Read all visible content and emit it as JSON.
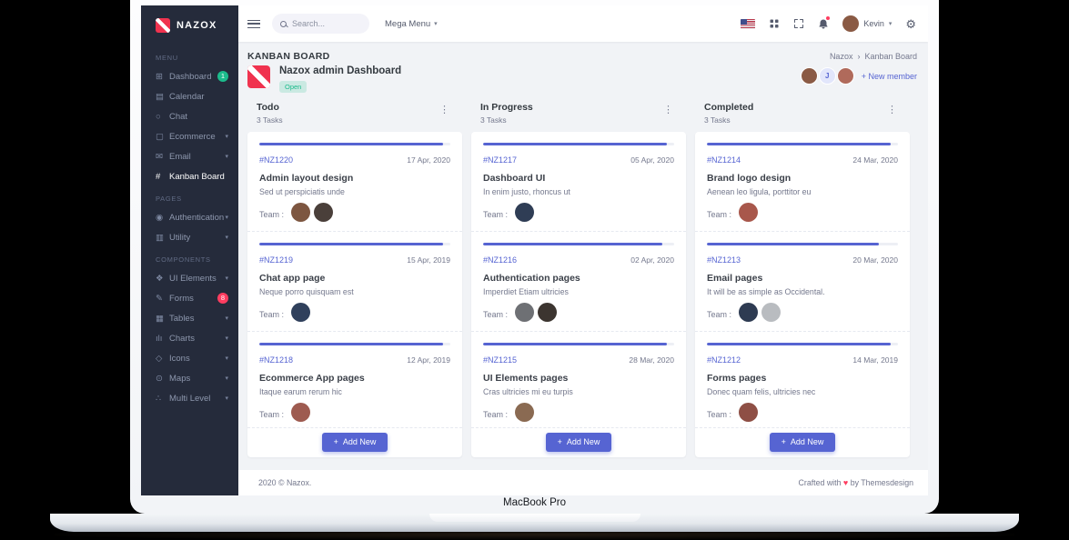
{
  "device": {
    "label": "MacBook Pro"
  },
  "colors": {
    "accent": "#5664d2",
    "success": "#1cbb8c",
    "danger": "#ff3d60",
    "sidebar_bg": "#252b3b"
  },
  "icons": {
    "chevron_down": "▾",
    "breadcrumb_sep": "›",
    "dots_vertical": "⋮",
    "plus": "+",
    "heart": "♥",
    "gear": "⚙",
    "dashboard": "⊞",
    "calendar": "▤",
    "chat": "○",
    "ecommerce": "▢",
    "email": "✉",
    "kanban": "#",
    "authentication": "◉",
    "utility": "▥",
    "ui_elements": "❖",
    "forms": "✎",
    "tables": "▦",
    "charts": "ılı",
    "icons_item": "◇",
    "maps": "⊙",
    "multi_level": "∴"
  },
  "sidebar": {
    "brand": "NAZOX",
    "sections": [
      {
        "label": "MENU",
        "items": [
          {
            "label": "Dashboard",
            "badge": "1"
          },
          {
            "label": "Calendar"
          },
          {
            "label": "Chat"
          },
          {
            "label": "Ecommerce"
          },
          {
            "label": "Email"
          },
          {
            "label": "Kanban Board"
          }
        ]
      },
      {
        "label": "PAGES",
        "items": [
          {
            "label": "Authentication"
          },
          {
            "label": "Utility"
          }
        ]
      },
      {
        "label": "COMPONENTS",
        "items": [
          {
            "label": "UI Elements"
          },
          {
            "label": "Forms",
            "badge": "8"
          },
          {
            "label": "Tables"
          },
          {
            "label": "Charts"
          },
          {
            "label": "Icons"
          },
          {
            "label": "Maps"
          },
          {
            "label": "Multi Level"
          }
        ]
      }
    ]
  },
  "topbar": {
    "search_placeholder": "Search...",
    "mega_menu": "Mega Menu",
    "user": "Kevin"
  },
  "page": {
    "title": "KANBAN BOARD",
    "breadcrumb": [
      "Nazox",
      "Kanban Board"
    ],
    "project": {
      "name": "Nazox admin Dashboard",
      "status": "Open",
      "add_member": "New member",
      "members": [
        {
          "bg": "#8a5a44"
        },
        {
          "letter": "J",
          "bg": "#e2e6fb",
          "fg": "#5664d2"
        },
        {
          "bg": "#b06a5b"
        }
      ]
    }
  },
  "board": {
    "team_label": "Team :",
    "add_new": "Add New",
    "columns": [
      {
        "title": "Todo",
        "count": "3 Tasks",
        "cards": [
          {
            "id": "#NZ1220",
            "date": "17 Apr, 2020",
            "title": "Admin layout design",
            "desc": "Sed ut perspiciatis unde",
            "progress": 96,
            "team": [
              {
                "bg": "#7d5640"
              },
              {
                "bg": "#4a3f3a"
              }
            ]
          },
          {
            "id": "#NZ1219",
            "date": "15 Apr, 2019",
            "title": "Chat app page",
            "desc": "Neque porro quisquam est",
            "progress": 96,
            "team": [
              {
                "bg": "#30405c"
              }
            ]
          },
          {
            "id": "#NZ1218",
            "date": "12 Apr, 2019",
            "title": "Ecommerce App pages",
            "desc": "Itaque earum rerum hic",
            "progress": 96,
            "team": [
              {
                "bg": "#9e5b50"
              }
            ]
          }
        ]
      },
      {
        "title": "In Progress",
        "count": "3 Tasks",
        "cards": [
          {
            "id": "#NZ1217",
            "date": "05 Apr, 2020",
            "title": "Dashboard UI",
            "desc": "In enim justo, rhoncus ut",
            "progress": 96,
            "team": [
              {
                "bg": "#2f3d55"
              }
            ]
          },
          {
            "id": "#NZ1216",
            "date": "02 Apr, 2020",
            "title": "Authentication pages",
            "desc": "Imperdiet Etiam ultricies",
            "progress": 94,
            "team": [
              {
                "bg": "#6e7074"
              },
              {
                "bg": "#3c3530"
              }
            ]
          },
          {
            "id": "#NZ1215",
            "date": "28 Mar, 2020",
            "title": "UI Elements pages",
            "desc": "Cras ultricies mi eu turpis",
            "progress": 96,
            "team": [
              {
                "bg": "#8a6a52"
              }
            ]
          }
        ]
      },
      {
        "title": "Completed",
        "count": "3 Tasks",
        "cards": [
          {
            "id": "#NZ1214",
            "date": "24 Mar, 2020",
            "title": "Brand logo design",
            "desc": "Aenean leo ligula, porttitor eu",
            "progress": 96,
            "team": [
              {
                "bg": "#a8574b"
              }
            ]
          },
          {
            "id": "#NZ1213",
            "date": "20 Mar, 2020",
            "title": "Email pages",
            "desc": "It will be as simple as Occidental.",
            "progress": 90,
            "team": [
              {
                "bg": "#2e3b52"
              },
              {
                "bg": "#b9bcc0"
              }
            ]
          },
          {
            "id": "#NZ1212",
            "date": "14 Mar, 2019",
            "title": "Forms pages",
            "desc": "Donec quam felis, ultricies nec",
            "progress": 96,
            "team": [
              {
                "bg": "#8e4f45"
              }
            ]
          }
        ]
      }
    ]
  },
  "footer": {
    "copyright": "2020 © Nazox.",
    "crafted_prefix": "Crafted with",
    "crafted_suffix": "by Themesdesign"
  }
}
